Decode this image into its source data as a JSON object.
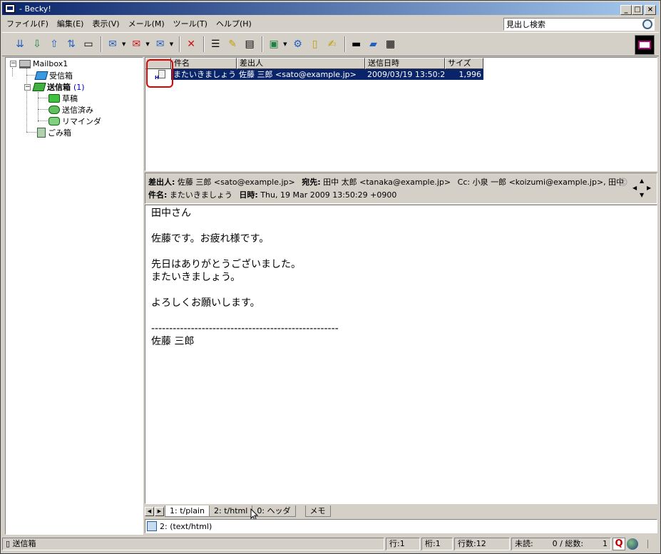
{
  "window": {
    "title": "- Becky!"
  },
  "menubar": {
    "items": [
      "ファイル(F)",
      "編集(E)",
      "表示(V)",
      "メール(M)",
      "ツール(T)",
      "ヘルプ(H)"
    ]
  },
  "search": {
    "placeholder": "見出し検索"
  },
  "tree": {
    "mailbox": "Mailbox1",
    "inbox": "受信箱",
    "outbox": "送信箱",
    "outbox_count": "(1)",
    "draft": "草稿",
    "sent": "送信済み",
    "reminder": "リマインダ",
    "trash": "ごみ箱"
  },
  "list": {
    "columns": [
      "件名",
      "差出人",
      "送信日時",
      "サイズ"
    ],
    "rows": [
      {
        "subject": "またいきましょう",
        "from": "佐藤 三郎 <sato@example.jp>",
        "date": "2009/03/19 13:50:29",
        "size": "1,996"
      }
    ]
  },
  "header": {
    "from_label": "差出人:",
    "from": "佐藤 三郎 <sato@example.jp>",
    "to_label": "宛先:",
    "to": "田中 太郎 <tanaka@example.jp>",
    "cc": "Cc: 小泉 一郎 <koizumi@example.jp>, 田中",
    "subject_label": "件名:",
    "subject": "またいきましょう",
    "date_label": "日時:",
    "date": "Thu, 19 Mar 2009 13:50:29 +0900"
  },
  "message_body": "田中さん\n\n佐藤です。お疲れ様です。\n\n先日はありがとうございました。\nまたいきましょう。\n\nよろしくお願いします。\n\n----------------------------------------------------\n佐藤 三郎",
  "tabs": [
    "1: t/plain",
    "2: t/html",
    "0: ヘッダ",
    "メモ"
  ],
  "part": {
    "label": "2: (text/html)"
  },
  "statusbar": {
    "folder": "送信箱",
    "line": "行:1",
    "column": "桁:1",
    "line_count": "行数:12",
    "unread": "未読:",
    "unread_total": "0 / 総数:",
    "total": "1",
    "q_label": "Q"
  }
}
